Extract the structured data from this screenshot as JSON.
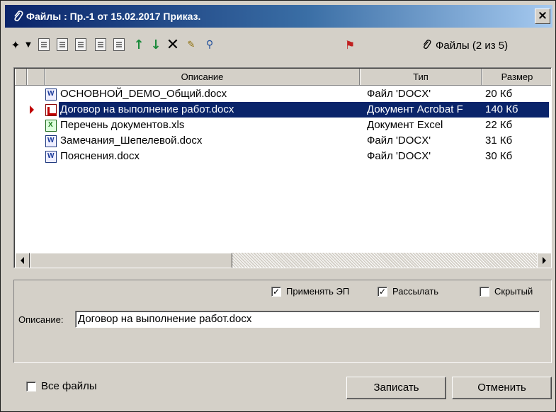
{
  "window": {
    "title": "Файлы : Пр.-1 от 15.02.2017 Приказ.",
    "close_label": "×"
  },
  "toolbar": {
    "files_count_label": "Файлы (2 из 5)",
    "icons": [
      "add-file-icon",
      "dropdown-arrow-icon",
      "copy-file-icon",
      "view-file-icon",
      "edit-file-icon",
      "compare-icon",
      "paste-icon",
      "move-up-icon",
      "move-down-icon",
      "delete-icon",
      "sign-icon",
      "verify-icon",
      "priority-icon",
      "paperclip-icon"
    ]
  },
  "grid": {
    "columns": [
      {
        "label": "Описание"
      },
      {
        "label": "Тип"
      },
      {
        "label": "Размер"
      }
    ],
    "rows": [
      {
        "name": "ОСНОВНОЙ_DEMO_Общий.docx",
        "type": "Файл 'DOCX'",
        "size": "20 Кб",
        "icon": "word-doc-icon",
        "selected": false
      },
      {
        "name": "Договор на выполнение работ.docx",
        "type": "Документ Acrobat F",
        "size": "140 Кб",
        "icon": "pdf-doc-icon",
        "selected": true
      },
      {
        "name": "Перечень документов.xls",
        "type": "Документ Excel",
        "size": "22 Кб",
        "icon": "excel-doc-icon",
        "selected": false
      },
      {
        "name": "Замечания_Шепелевой.docx",
        "type": "Файл 'DOCX'",
        "size": "31 Кб",
        "icon": "word-doc-icon",
        "selected": false
      },
      {
        "name": "Пояснения.docx",
        "type": "Файл 'DOCX'",
        "size": "30 Кб",
        "icon": "word-doc-icon",
        "selected": false
      }
    ]
  },
  "properties": {
    "apply_ep_label": "Применять ЭП",
    "apply_ep_checked": true,
    "send_label": "Рассылать",
    "send_checked": true,
    "hidden_label": "Скрытый",
    "hidden_checked": false,
    "description_label": "Описание:",
    "description_value": "Договор на выполнение работ.docx"
  },
  "footer": {
    "all_files_label": "Все файлы",
    "all_files_checked": false,
    "save_label": "Записать",
    "cancel_label": "Отменить"
  },
  "colors": {
    "selection": "#0a246a",
    "title_gradient_start": "#0a246a",
    "title_gradient_end": "#a6caf0"
  }
}
